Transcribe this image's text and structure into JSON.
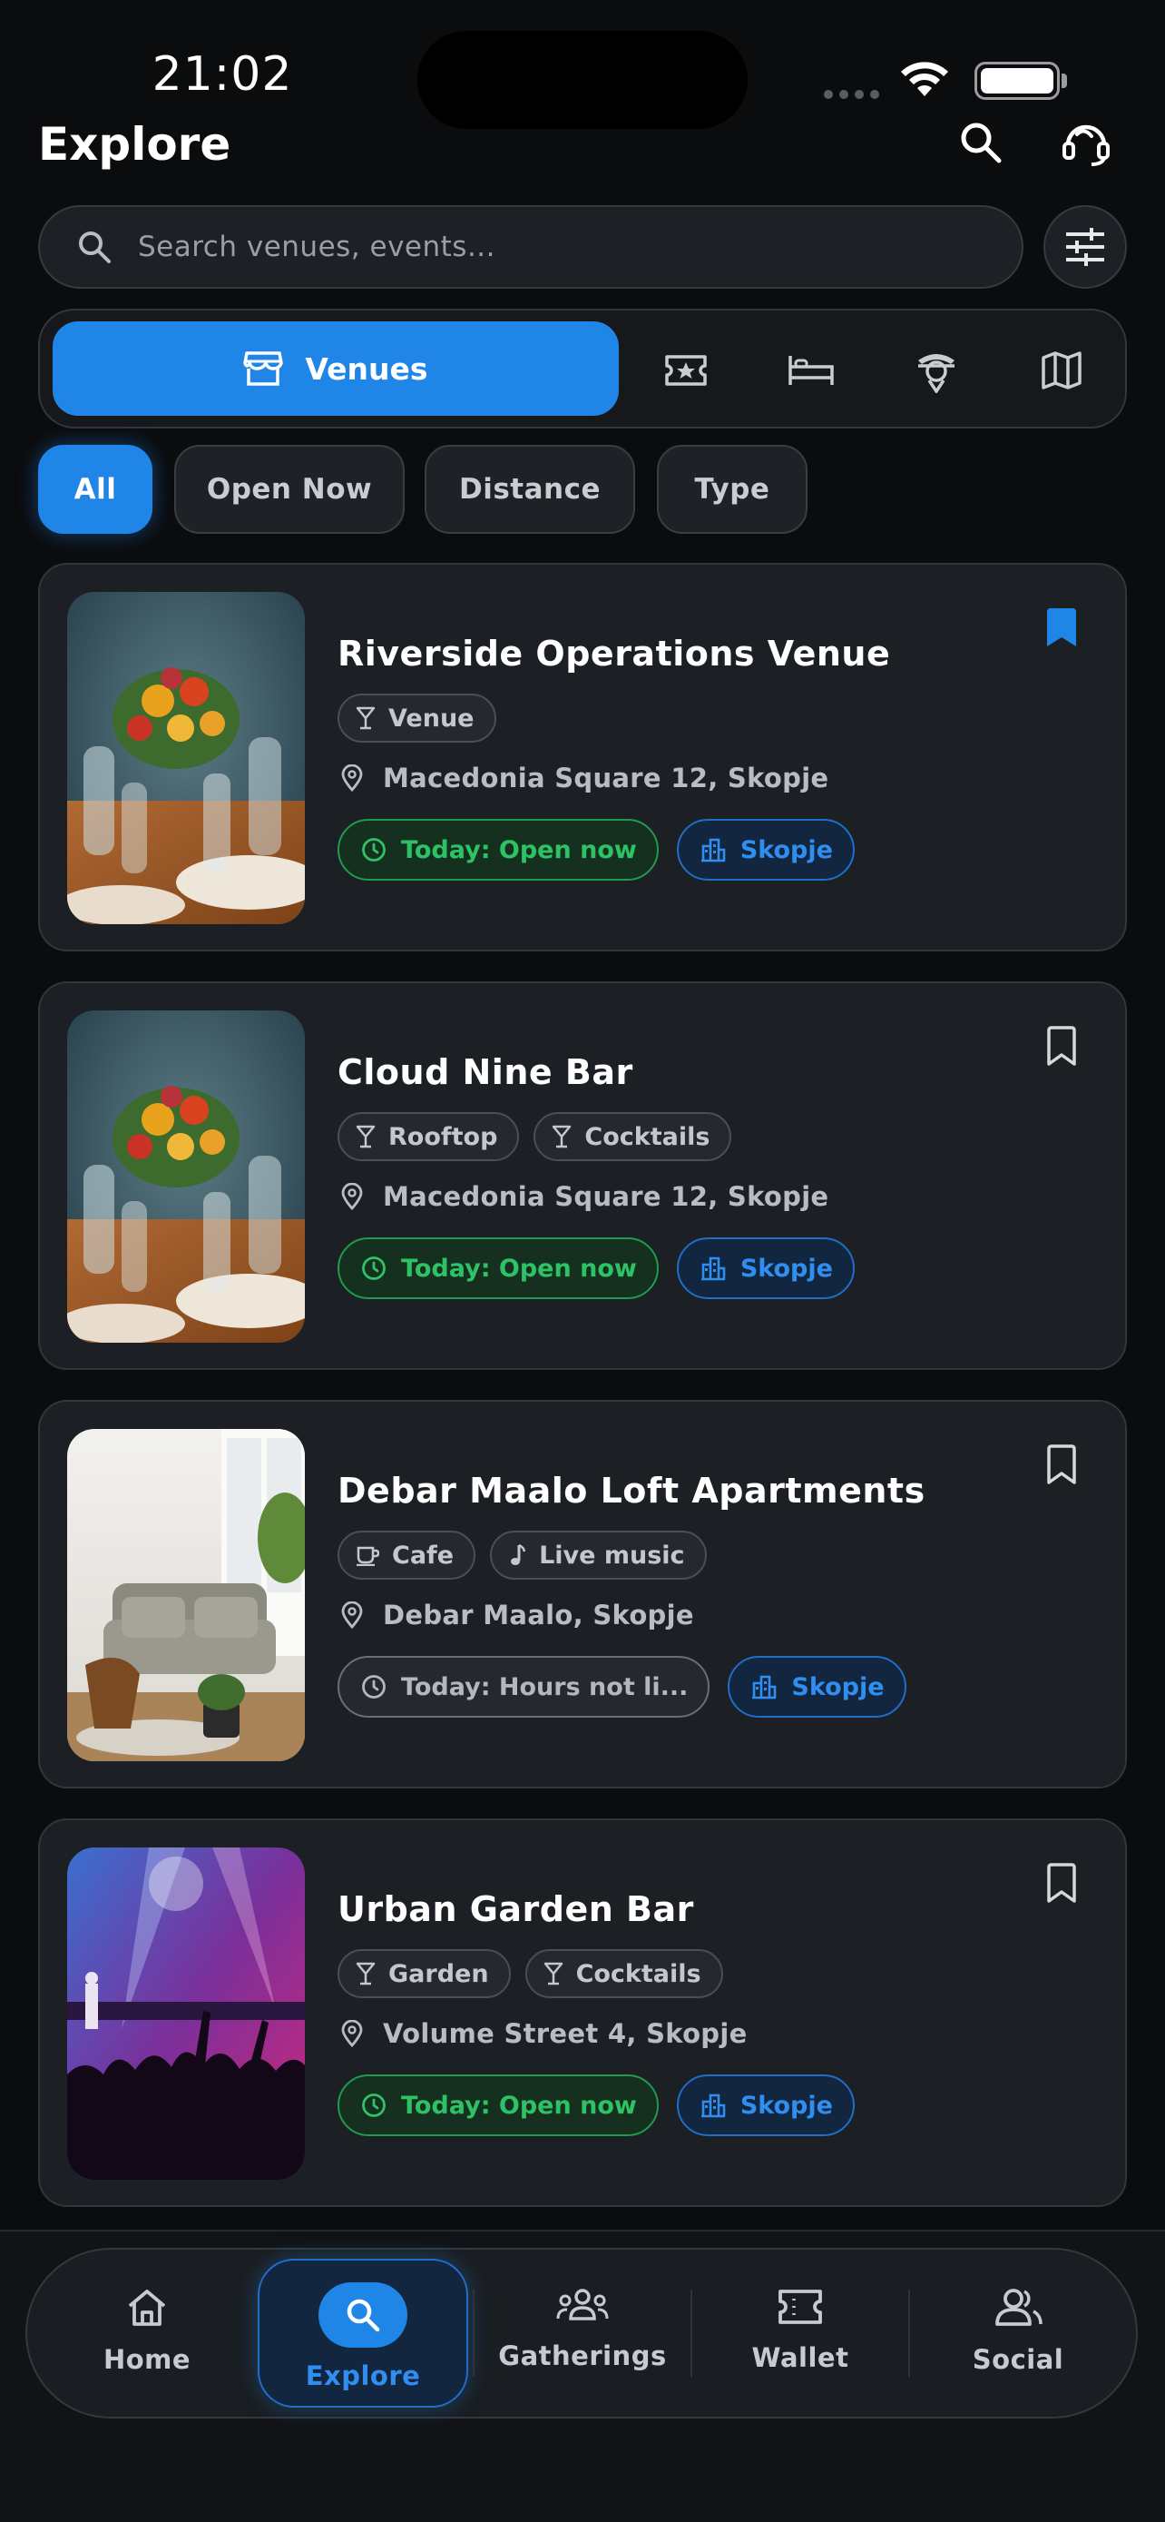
{
  "status_bar": {
    "time": "21:02"
  },
  "header": {
    "title": "Explore",
    "search_icon": "search-icon",
    "profile_icon": "headset-icon"
  },
  "search": {
    "placeholder": "Search venues, events..."
  },
  "segments": [
    {
      "label": "Venues",
      "icon": "storefront-icon",
      "active": true
    },
    {
      "icon": "ticket-star-icon"
    },
    {
      "icon": "bed-icon"
    },
    {
      "icon": "guide-icon"
    },
    {
      "icon": "map-icon"
    }
  ],
  "chips": [
    {
      "label": "All",
      "active": true
    },
    {
      "label": "Open Now"
    },
    {
      "label": "Distance"
    },
    {
      "label": "Type"
    }
  ],
  "venues": [
    {
      "name": "Riverside Operations Venue",
      "tags": [
        {
          "icon": "cocktail-icon",
          "label": "Venue"
        }
      ],
      "address": "Macedonia Square 12, Skopje",
      "hours": "Today: Open now",
      "city": "Skopje",
      "bookmarked": true,
      "image": "dining-table-flowers"
    },
    {
      "name": "Cloud Nine Bar",
      "tags": [
        {
          "icon": "cocktail-icon",
          "label": "Rooftop"
        },
        {
          "icon": "cocktail-icon",
          "label": "Cocktails"
        }
      ],
      "address": "Macedonia Square 12, Skopje",
      "hours": "Today: Open now",
      "city": "Skopje",
      "bookmarked": false,
      "image": "dining-table-flowers"
    },
    {
      "name": "Debar Maalo Loft Apartments",
      "tags": [
        {
          "icon": "coffee-icon",
          "label": "Cafe"
        },
        {
          "icon": "music-note-icon",
          "label": "Live music"
        }
      ],
      "address": "Debar Maalo, Skopje",
      "hours": "Today: Hours not li...",
      "city": "Skopje",
      "bookmarked": false,
      "image": "living-room"
    },
    {
      "name": "Urban Garden Bar",
      "tags": [
        {
          "icon": "cocktail-icon",
          "label": "Garden"
        },
        {
          "icon": "cocktail-icon",
          "label": "Cocktails"
        }
      ],
      "address": "Volume Street 4, Skopje",
      "hours": "Today: Open now",
      "city": "Skopje",
      "bookmarked": false,
      "image": "concert-crowd"
    }
  ],
  "nav": [
    {
      "label": "Home",
      "icon": "home-icon"
    },
    {
      "label": "Explore",
      "icon": "search-icon",
      "active": true
    },
    {
      "label": "Gatherings",
      "icon": "group-icon"
    },
    {
      "label": "Wallet",
      "icon": "ticket-icon"
    },
    {
      "label": "Social",
      "icon": "people-icon"
    }
  ],
  "colors": {
    "accent": "#1f86e8",
    "open_green": "#2ec266",
    "background": "#0b0c0e",
    "card": "#1c1f23"
  }
}
